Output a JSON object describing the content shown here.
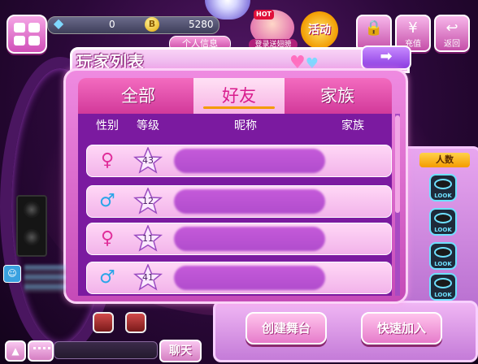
{
  "top_bar": {
    "diamonds": "0",
    "coin_symbol": "B",
    "coins": "5280",
    "personal_info_label": "个人信息",
    "hot_badge": "HOT",
    "hot_label": "登录送翅膀",
    "event_label": "活动",
    "recharge_icon": "¥",
    "recharge_label": "充值",
    "back_label": "返回"
  },
  "dialog": {
    "title": "玩家列表",
    "next_arrow": "➡",
    "tabs": [
      {
        "label": "全部",
        "active": false
      },
      {
        "label": "好友",
        "active": true
      },
      {
        "label": "家族",
        "active": false
      }
    ],
    "headers": {
      "gender": "性别",
      "level": "等级",
      "nickname": "昵称",
      "family": "家族"
    },
    "rows": [
      {
        "gender": "female",
        "level": "43"
      },
      {
        "gender": "male",
        "level": "12"
      },
      {
        "gender": "female",
        "level": "11"
      },
      {
        "gender": "male",
        "level": "41"
      }
    ]
  },
  "side_panel": {
    "header": "人数",
    "look_label": "LOOK"
  },
  "bottom_panel": {
    "create_stage": "创建舞台",
    "quick_join": "快速加入"
  },
  "chat": {
    "send_label": "聊天",
    "up_arrow": "▲"
  },
  "colors": {
    "accent_pink": "#e02e9a",
    "male_blue": "#2aa5e8",
    "tab_active_text": "#d91d8e",
    "panel_purple": "#7b1aa0"
  }
}
